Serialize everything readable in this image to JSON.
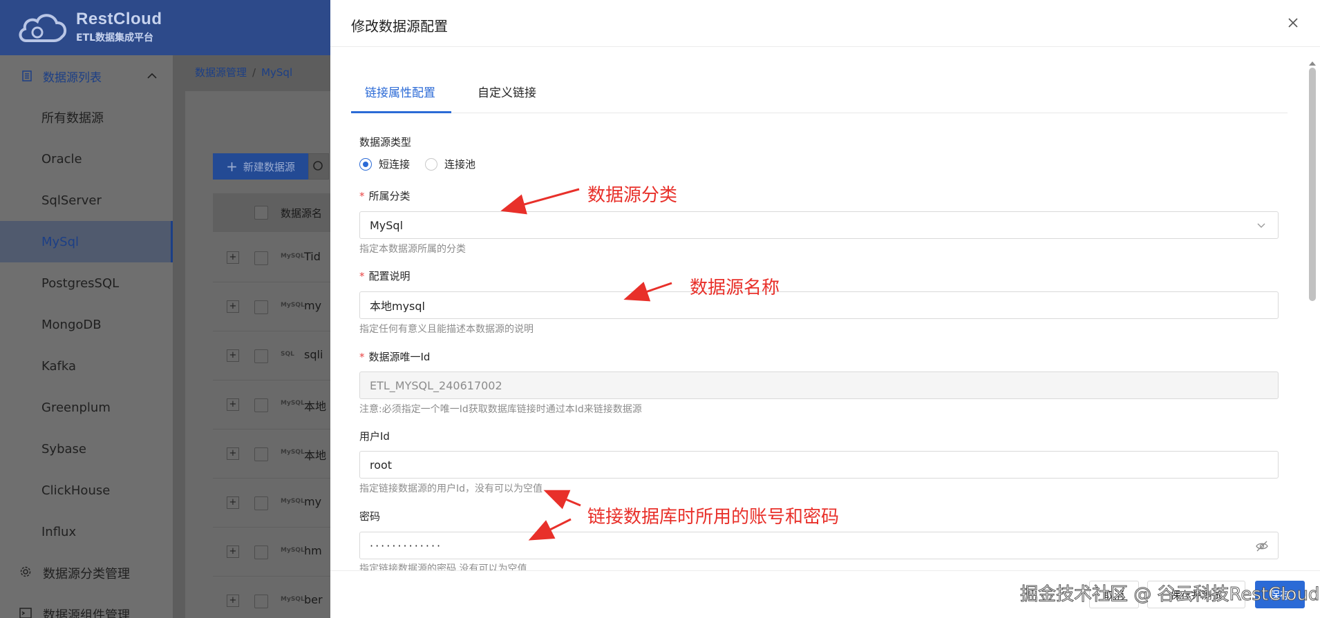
{
  "app": {
    "brand_title": "RestCloud",
    "brand_subtitle": "ETL数据集成平台"
  },
  "sidebar": {
    "group_label": "数据源列表",
    "items": [
      {
        "label": "所有数据源"
      },
      {
        "label": "Oracle"
      },
      {
        "label": "SqlServer"
      },
      {
        "label": "MySql"
      },
      {
        "label": "PostgresSQL"
      },
      {
        "label": "MongoDB"
      },
      {
        "label": "Kafka"
      },
      {
        "label": "Greenplum"
      },
      {
        "label": "Sybase"
      },
      {
        "label": "ClickHouse"
      },
      {
        "label": "Influx"
      }
    ],
    "footer_items": [
      {
        "label": "数据源分类管理"
      },
      {
        "label": "数据源组件管理"
      }
    ]
  },
  "breadcrumb": {
    "root": "数据源管理",
    "separator": "/",
    "current": "MySql"
  },
  "list": {
    "new_button": "新建数据源",
    "column_name": "数据源名",
    "rows": [
      {
        "icon": "MySQL",
        "name": "Tid"
      },
      {
        "icon": "MySQL",
        "name": "my"
      },
      {
        "icon": "SQL",
        "name": "sqli"
      },
      {
        "icon": "MySQL",
        "name": "本地"
      },
      {
        "icon": "MySQL",
        "name": "本地"
      },
      {
        "icon": "MySQL",
        "name": "my"
      },
      {
        "icon": "MySQL",
        "name": "hm"
      },
      {
        "icon": "MySQL",
        "name": "ber"
      }
    ]
  },
  "drawer": {
    "title": "修改数据源配置",
    "tabs": [
      {
        "label": "链接属性配置",
        "active": true
      },
      {
        "label": "自定义链接",
        "active": false
      }
    ],
    "form": {
      "type_label": "数据源类型",
      "type_options": [
        {
          "label": "短连接",
          "checked": true
        },
        {
          "label": "连接池",
          "checked": false
        }
      ],
      "category_label": "所属分类",
      "category_value": "MySql",
      "category_hint": "指定本数据源所属的分类",
      "desc_label": "配置说明",
      "desc_value": "本地mysql",
      "desc_hint": "指定任何有意义且能描述本数据源的说明",
      "id_label": "数据源唯一Id",
      "id_value": "ETL_MYSQL_240617002",
      "id_hint": "注意:必须指定一个唯一Id获取数据库链接时通过本Id来链接数据源",
      "user_label": "用户Id",
      "user_value": "root",
      "user_hint": "指定链接数据源的用户Id，没有可以为空值",
      "pwd_label": "密码",
      "pwd_value": "·············",
      "pwd_hint": "指定链接数据源的密码,没有可以为空值"
    },
    "footer": {
      "btn1": "取消",
      "btn2": "保存并测试",
      "btn3": "保存"
    }
  },
  "annotations": {
    "a1": "数据源分类",
    "a2": "数据源名称",
    "a3": "链接数据库时所用的账号和密码",
    "color": "#e8302a"
  },
  "watermark": "掘金技术社区 @ 谷云科技RestCloud"
}
